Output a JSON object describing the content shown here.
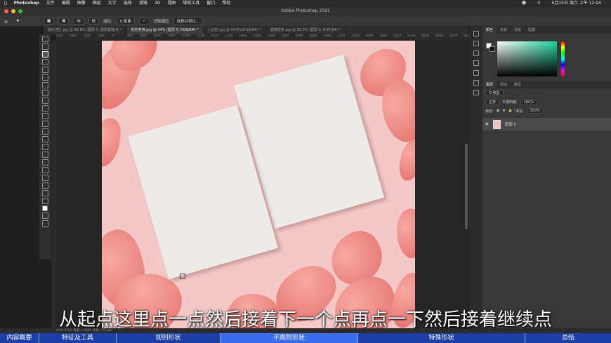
{
  "mac_menu": {
    "app_name": "Photoshop",
    "items": [
      "文件",
      "编辑",
      "图像",
      "图层",
      "文字",
      "选择",
      "滤镜",
      "3D",
      "视图",
      "增效工具",
      "窗口",
      "帮助"
    ],
    "clock": "5月15日 周六 上午 12:04"
  },
  "window_title": "Adobe Photoshop 2021",
  "options_bar": {
    "feather_label": "羽化:",
    "feather_value": "0 像素",
    "antialias_label": "消除锯齿",
    "select_mask_button": "选择并遮住..."
  },
  "tabs": [
    {
      "label": "圆形选区.jpg @ 48.5% (图层 0, 图层蒙版/8) *",
      "active": false
    },
    {
      "label": "矩形变换.jpg @ 44% (图层 0, RGB/8#) *",
      "active": true
    },
    {
      "label": "六边形.jpg @ 94.8%(RGB/8#) *",
      "active": false
    },
    {
      "label": "圆角矩形.jpg @ 33.3% (图层 0, RGB/8#) *",
      "active": false
    }
  ],
  "ruler_ticks": [
    "800",
    "600",
    "400",
    "200",
    "0",
    "200",
    "400",
    "600",
    "800",
    "1000",
    "1200",
    "1400",
    "1600",
    "1800",
    "2000",
    "2200",
    "2400",
    "2600",
    "2800",
    "3000",
    "3200",
    "3400",
    "3600",
    "3800",
    "4000",
    "4200",
    "4400",
    "4600",
    "4800",
    "5000"
  ],
  "panels": {
    "color_tabs": [
      "颜色",
      "色板",
      "渐变",
      "图案"
    ],
    "layer_tabs": [
      "图层",
      "通道",
      "路径"
    ],
    "filter_kind": "Q 类型",
    "blend_mode": "正常",
    "opacity_label": "不透明度:",
    "opacity_value": "100%",
    "lock_label": "锁定:",
    "fill_label": "填充:",
    "fill_value": "100%",
    "layer_name": "图层 0"
  },
  "status": "44%   3702 像素 x 5000 像素 (72 ppi)",
  "subtitle": "从起点这里点一点然后接着下一个点再点一下然后接着继续点",
  "bottom_nav": [
    {
      "label": "内容概要",
      "active": false
    },
    {
      "label": "特征及工具",
      "active": false
    },
    {
      "label": "规则形状",
      "active": false
    },
    {
      "label": "不规则形状",
      "active": true
    },
    {
      "label": "特殊形状",
      "active": false
    },
    {
      "label": "总结",
      "active": false
    }
  ],
  "colors": {
    "accent": "#3a6cf0",
    "nav_bg": "#1c3fa8",
    "canvas_pink": "#f3c8c6"
  }
}
